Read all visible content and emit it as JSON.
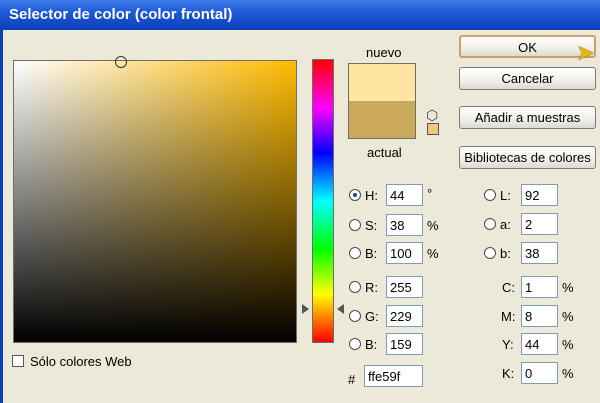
{
  "window": {
    "title": "Selector de color (color frontal)"
  },
  "preview": {
    "new_label": "nuevo",
    "current_label": "actual",
    "new_color": "#ffe59f",
    "current_color": "#c9aa5c"
  },
  "buttons": {
    "ok": "OK",
    "cancel": "Cancelar",
    "add_swatch": "Añadir a muestras",
    "libraries": "Bibliotecas de colores"
  },
  "hsb": {
    "h": {
      "label": "H:",
      "value": "44",
      "unit": "°"
    },
    "s": {
      "label": "S:",
      "value": "38",
      "unit": "%"
    },
    "b": {
      "label": "B:",
      "value": "100",
      "unit": "%"
    }
  },
  "rgb": {
    "r": {
      "label": "R:",
      "value": "255"
    },
    "g": {
      "label": "G:",
      "value": "229"
    },
    "b": {
      "label": "B:",
      "value": "159"
    }
  },
  "lab": {
    "l": {
      "label": "L:",
      "value": "92"
    },
    "a": {
      "label": "a:",
      "value": "2"
    },
    "b": {
      "label": "b:",
      "value": "38"
    }
  },
  "cmyk": {
    "c": {
      "label": "C:",
      "value": "1",
      "unit": "%"
    },
    "m": {
      "label": "M:",
      "value": "8",
      "unit": "%"
    },
    "y": {
      "label": "Y:",
      "value": "44",
      "unit": "%"
    },
    "k": {
      "label": "K:",
      "value": "0",
      "unit": "%"
    }
  },
  "hex": {
    "label": "#",
    "value": "ffe59f"
  },
  "web_only": {
    "label": "Sólo colores Web",
    "checked": false
  }
}
